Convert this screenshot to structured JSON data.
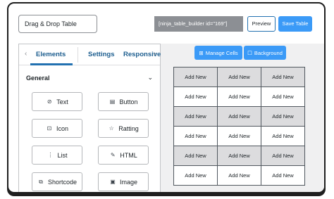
{
  "header": {
    "table_title": "Drag & Drop Table",
    "shortcode": "[ninja_table_builder id=\"169\"]",
    "preview_label": "Preview",
    "save_label": "Save Table"
  },
  "sidebar": {
    "tabs": [
      {
        "label": "Elements",
        "active": true
      },
      {
        "label": "Settings",
        "active": false
      },
      {
        "label": "Responsiver",
        "active": false
      }
    ],
    "section_title": "General",
    "elements": [
      {
        "label": "Text",
        "icon": "text-icon"
      },
      {
        "label": "Button",
        "icon": "button-icon"
      },
      {
        "label": "Icon",
        "icon": "icon-element-icon"
      },
      {
        "label": "Ratting",
        "icon": "star-icon"
      },
      {
        "label": "List",
        "icon": "list-icon"
      },
      {
        "label": "HTML",
        "icon": "html-icon"
      },
      {
        "label": "Shortcode",
        "icon": "shortcode-icon"
      },
      {
        "label": "Image",
        "icon": "image-icon"
      }
    ]
  },
  "toolbar": {
    "manage_cells_label": "Manage Cells",
    "background_label": "Background"
  },
  "grid": {
    "cell_label": "Add New",
    "rows": 6,
    "columns": 3
  },
  "colors": {
    "accent": "#3b9af7",
    "tab_text": "#1d5e8f",
    "shortcode_bg": "#8c8f94",
    "shaded_row": "#dcdcde"
  }
}
